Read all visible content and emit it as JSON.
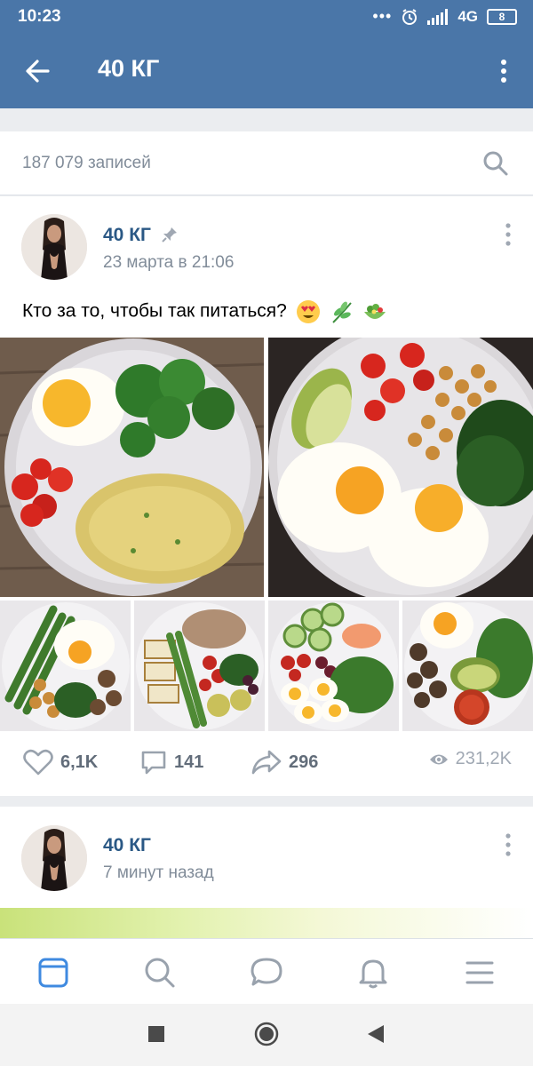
{
  "status_bar": {
    "time": "10:23",
    "network": "4G",
    "battery": "8"
  },
  "app_bar": {
    "title": "40 КГ"
  },
  "search": {
    "count_text": "187 079 записей"
  },
  "post": {
    "author": "40 КГ",
    "date": "23 марта в 21:06",
    "text": "Кто за то, чтобы так питаться?",
    "likes": "6,1K",
    "comments": "141",
    "shares": "296",
    "views": "231,2K"
  },
  "post2": {
    "author": "40 КГ",
    "date": "7 минут назад"
  },
  "colors": {
    "header": "#4a76a8",
    "link": "#2a5885",
    "tab_active": "#3f8ae0",
    "muted": "#818c99"
  },
  "icons": {
    "back": "back-arrow-icon",
    "menu": "more-vertical-icon",
    "search": "search-icon",
    "pin": "pin-icon",
    "like": "heart-icon",
    "comment": "comment-icon",
    "share": "share-icon",
    "views": "eye-icon",
    "tabs": [
      "news-icon",
      "discover-icon",
      "messages-icon",
      "notifications-icon",
      "menu-icon"
    ]
  }
}
